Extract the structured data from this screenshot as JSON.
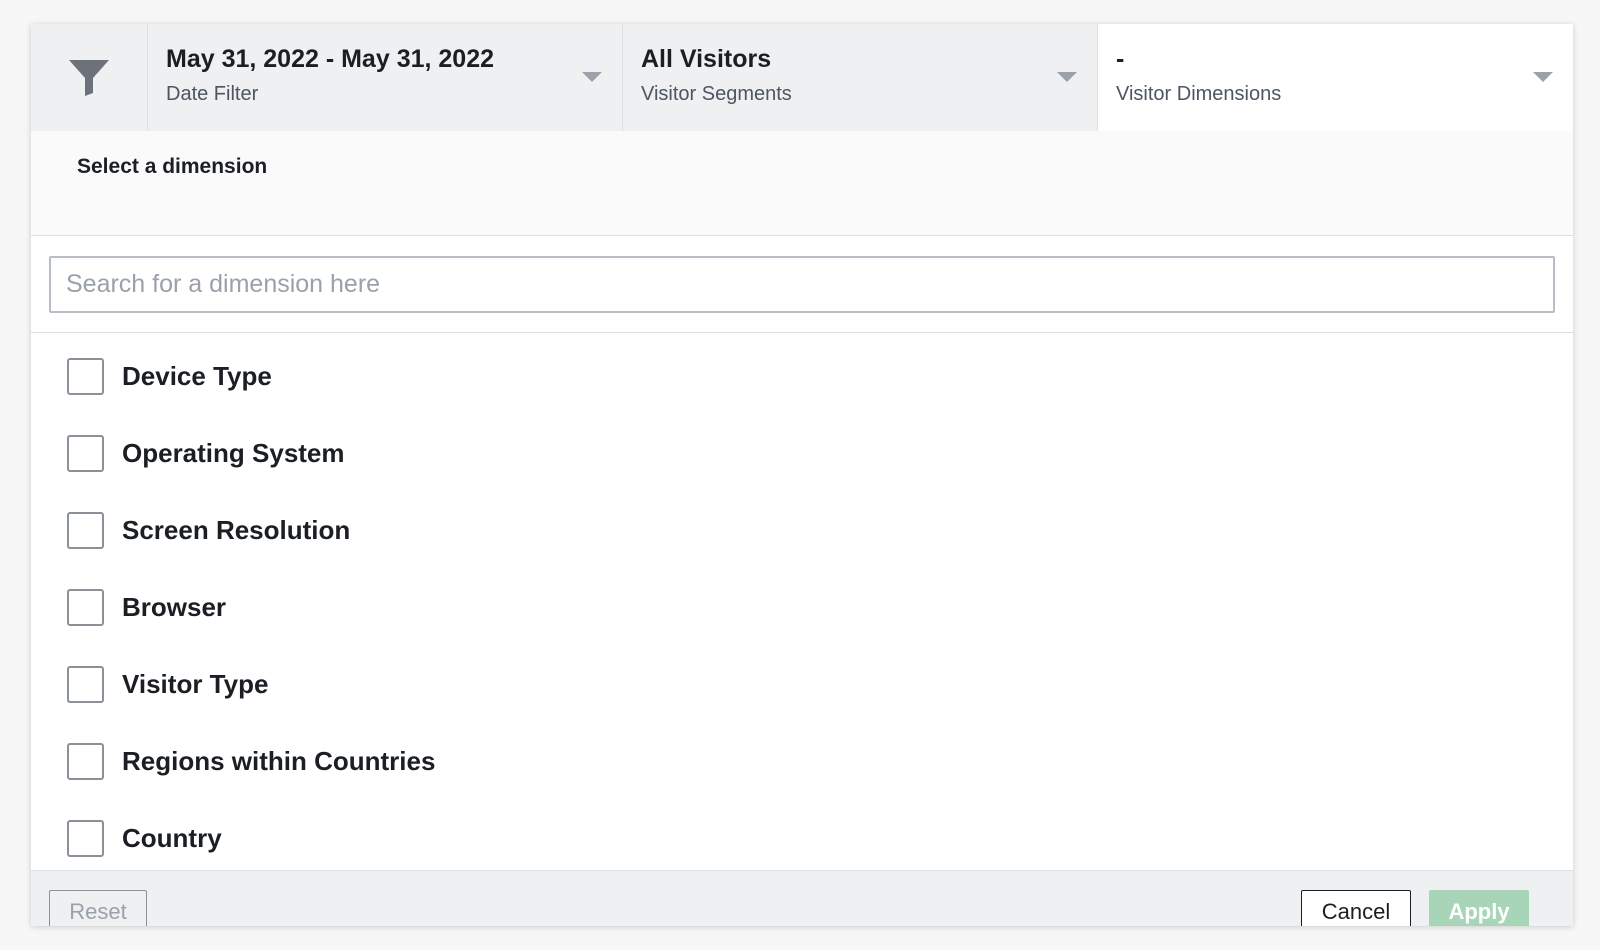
{
  "filter_bar": {
    "date": {
      "value": "May 31, 2022 - May 31, 2022",
      "label": "Date Filter"
    },
    "segments": {
      "value": "All Visitors",
      "label": "Visitor Segments"
    },
    "dimensions": {
      "value": "-",
      "label": "Visitor Dimensions"
    }
  },
  "dimension_panel": {
    "title": "Select a dimension",
    "search": {
      "placeholder": "Search for a dimension here",
      "value": ""
    },
    "items": [
      {
        "label": "Device Type",
        "checked": false
      },
      {
        "label": "Operating System",
        "checked": false
      },
      {
        "label": "Screen Resolution",
        "checked": false
      },
      {
        "label": "Browser",
        "checked": false
      },
      {
        "label": "Visitor Type",
        "checked": false
      },
      {
        "label": "Regions within Countries",
        "checked": false
      },
      {
        "label": "Country",
        "checked": false
      }
    ]
  },
  "footer": {
    "reset_label": "Reset",
    "cancel_label": "Cancel",
    "apply_label": "Apply"
  },
  "colors": {
    "apply_disabled": "#a8d5b8",
    "bar_background": "#eef0f2",
    "text_primary": "#1b1f24"
  }
}
